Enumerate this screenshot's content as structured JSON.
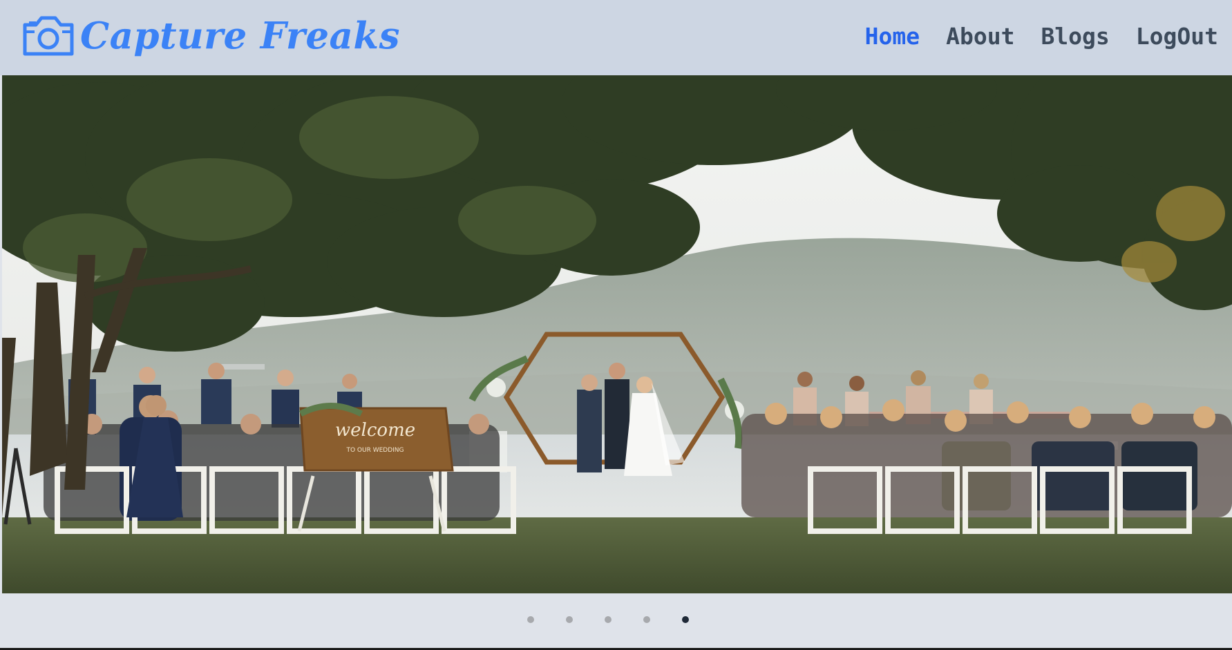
{
  "header": {
    "brand": {
      "name": "Capture Freaks",
      "icon": "camera-icon",
      "color": "#3b82f6"
    },
    "nav": [
      {
        "label": "Home",
        "active": true
      },
      {
        "label": "About",
        "active": false
      },
      {
        "label": "Blogs",
        "active": false
      },
      {
        "label": "LogOut",
        "active": false
      }
    ]
  },
  "carousel": {
    "slide_count": 5,
    "active_index": 4,
    "slide": {
      "subject": "outdoor wedding ceremony photo",
      "sign": {
        "line1": "welcome",
        "line2": "TO OUR WEDDING"
      }
    }
  },
  "colors": {
    "header_bg": "#cdd6e3",
    "accent": "#2563eb",
    "nav_text": "#3d4b5c",
    "page_bg": "#dfe3ea"
  }
}
